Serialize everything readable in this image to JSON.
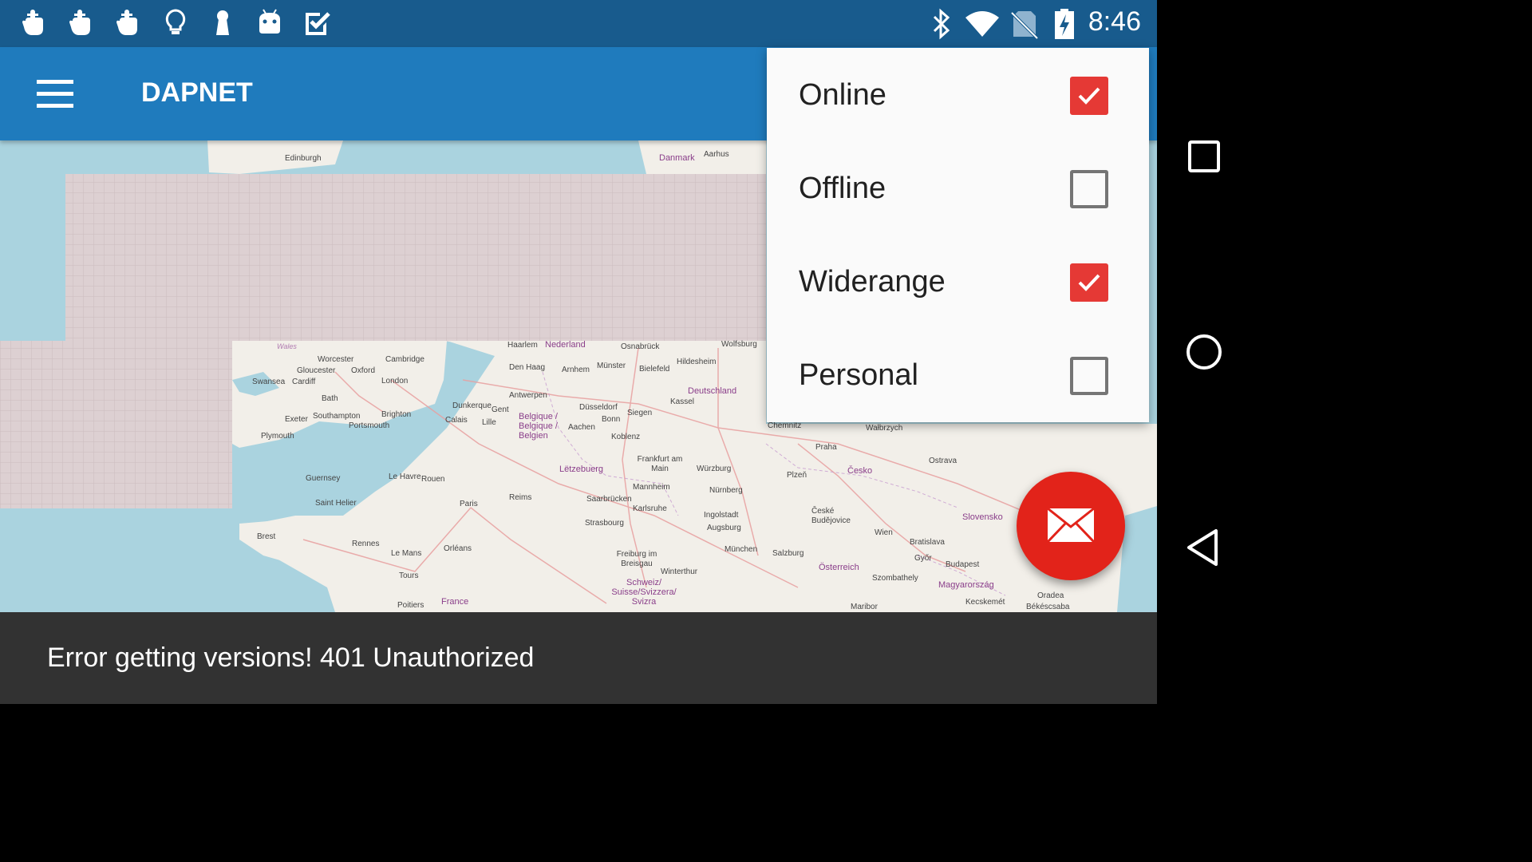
{
  "status_bar": {
    "clock": "8:46",
    "left_icons": [
      "touch-hand-icon",
      "touch-hand-icon",
      "touch-hand-icon",
      "lightbulb-icon",
      "keyhole-icon",
      "android-robot-icon",
      "checkbox-app-icon"
    ],
    "right_icons": [
      "bluetooth-icon",
      "wifi-icon",
      "no-sim-icon",
      "battery-charging-icon"
    ]
  },
  "app_bar": {
    "title": "DAPNET"
  },
  "popup_menu": {
    "items": [
      {
        "label": "Online",
        "checked": true
      },
      {
        "label": "Offline",
        "checked": false
      },
      {
        "label": "Widerange",
        "checked": true
      },
      {
        "label": "Personal",
        "checked": false
      }
    ]
  },
  "map": {
    "labels": {
      "edinburgh": "Edinburgh",
      "danmark": "Danmark",
      "aarhus": "Aarhus",
      "wales": "Wales",
      "worcester": "Worcester",
      "cambridge": "Cambridge",
      "gloucester": "Gloucester",
      "oxford": "Oxford",
      "swansea": "Swansea",
      "cardiff": "Cardiff",
      "london": "London",
      "bath": "Bath",
      "exeter": "Exeter",
      "southampton": "Southampton",
      "brighton": "Brighton",
      "portsmouth": "Portsmouth",
      "plymouth": "Plymouth",
      "haarlem": "Haarlem",
      "nederland": "Nederland",
      "den_haag": "Den Haag",
      "arnhem": "Arnhem",
      "osnabruck": "Osnabrück",
      "wolfsburg": "Wolfsburg",
      "munster": "Münster",
      "bielefeld": "Bielefeld",
      "hildesheim": "Hildesheim",
      "antwerpen": "Antwerpen",
      "dusseldorf": "Düsseldorf",
      "deutschland": "Deutschland",
      "kassel": "Kassel",
      "dunkerque": "Dunkerque",
      "gent": "Gent",
      "calais": "Calais",
      "lille": "Lille",
      "belgique": "Belgique / Belgique / Belgien",
      "aachen": "Aachen",
      "bonn": "Bonn",
      "siegen": "Siegen",
      "koblenz": "Koblenz",
      "chemnitz": "Chemnitz",
      "praha": "Praha",
      "walbrzych": "Wałbrzych",
      "frankfurt": "Frankfurt am Main",
      "letzebuerg": "Lëtzebuerg",
      "wurzburg": "Würzburg",
      "mannheim": "Mannheim",
      "nurnberg": "Nürnberg",
      "plzen": "Plzeň",
      "cesko": "Česko",
      "ostrava": "Ostrava",
      "guernsey": "Guernsey",
      "le_havre": "Le Havre",
      "rouen": "Rouen",
      "saint_helier": "Saint Helier",
      "paris": "Paris",
      "reims": "Reims",
      "saarbrucken": "Saarbrücken",
      "karlsruhe": "Karlsruhe",
      "ingolstadt": "Ingolstadt",
      "ceske_budejovice": "České Budějovice",
      "slovensko": "Slovensko",
      "strasbourg": "Strasbourg",
      "augsburg": "Augsburg",
      "brest": "Brest",
      "rennes": "Rennes",
      "le_mans": "Le Mans",
      "orleans": "Orléans",
      "munchen": "München",
      "salzburg": "Salzburg",
      "wien": "Wien",
      "bratislava": "Bratislava",
      "gyor": "Győr",
      "freiburg": "Freiburg im Breisgau",
      "winterthur": "Winterthur",
      "osterreich": "Österreich",
      "budapest": "Budapest",
      "tours": "Tours",
      "schweiz": "Schweiz/ Suisse/Svizzera/ Svizra",
      "szombathely": "Szombathely",
      "magyarorszag": "Magyarország",
      "france": "France",
      "poitiers": "Poitiers",
      "oradea": "Oradea",
      "kecskemet": "Kecskemét",
      "bekescsaba": "Békéscsaba",
      "maribor": "Maribor"
    }
  },
  "fab": {
    "icon": "envelope-icon"
  },
  "snackbar": {
    "message": "Error getting versions! 401 Unauthorized"
  },
  "nav_bar": {
    "icons": [
      "recents-square-icon",
      "home-circle-icon",
      "back-triangle-icon"
    ]
  }
}
